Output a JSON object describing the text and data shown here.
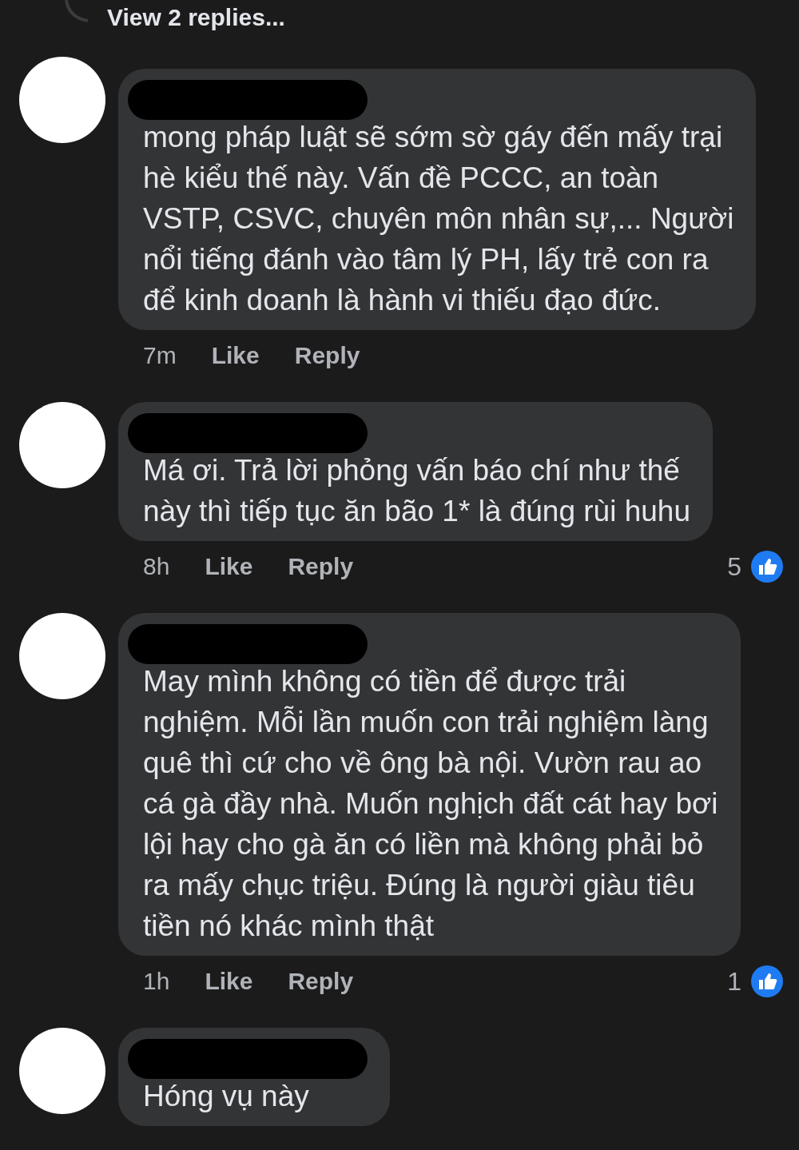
{
  "view_replies": {
    "label": "View 2 replies..."
  },
  "comments": [
    {
      "lines": [
        "mong pháp luật sẽ sớm sờ gáy đến mấy trại",
        "hè kiểu thế này. Vấn đề PCCC, an toàn",
        "VSTP, CSVC, chuyên môn nhân sự,... Người",
        "nổi tiếng đánh vào tâm lý PH, lấy trẻ con ra",
        "để kinh doanh là hành vi thiếu đạo đức."
      ],
      "time": "7m",
      "like": "Like",
      "reply": "Reply"
    },
    {
      "lines": [
        "Má ơi. Trả lời phỏng vấn báo chí như thế",
        "này thì tiếp tục ăn bão 1* là đúng rùi huhu"
      ],
      "time": "8h",
      "like": "Like",
      "reply": "Reply",
      "reactions": "5"
    },
    {
      "lines": [
        "May mình không có tiền để được trải",
        "nghiệm. Mỗi lần muốn con trải nghiệm làng",
        "quê thì cứ cho về ông bà nội. Vườn rau ao",
        "cá gà đầy nhà. Muốn nghịch đất cát hay bơi",
        "lội hay cho gà ăn có liền mà không phải bỏ",
        "ra mấy chục triệu. Đúng là người giàu tiêu",
        "tiền nó khác mình thật"
      ],
      "time": "1h",
      "like": "Like",
      "reply": "Reply",
      "reactions": "1"
    },
    {
      "lines": [
        "Hóng vụ này"
      ]
    }
  ]
}
